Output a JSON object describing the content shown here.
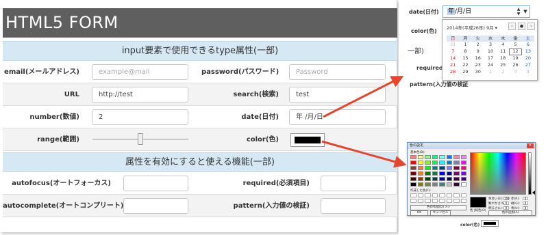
{
  "form": {
    "title": "HTML5 FORM",
    "section1_title": "input要素で使用できるtype属性(一部)",
    "section2_title": "属性を有効にすると使える機能(一部)",
    "rows": [
      {
        "left_label": "email(メールアドレス)",
        "left_placeholder": "example@mail",
        "right_label": "password(パスワード)",
        "right_placeholder": "Password"
      },
      {
        "left_label": "URL",
        "left_value": "http://test",
        "right_label": "search(検索)",
        "right_value": "test"
      },
      {
        "left_label": "number(数値)",
        "left_value": "2",
        "right_label": "date(日付)",
        "right_value": "年 /月/日"
      },
      {
        "left_label": "range(範囲)",
        "right_label": "color(色)"
      }
    ],
    "rows2": [
      {
        "left_label": "autofocus(オートフォーカス)",
        "right_label": "required(必須項目)"
      },
      {
        "left_label": "autocomplete(オートコンプリート)",
        "right_label": "pattern(入力値の検証)"
      }
    ],
    "range_value": 0.5,
    "color_value": "#000000"
  },
  "date_popup": {
    "field_label": "date(日付)",
    "input_year": "年",
    "input_rest": "/月/日",
    "spin_up": "▲",
    "spin_down": "▼",
    "dropdown": "▼",
    "month_label": "2014年(平成26年) 9月 ▾",
    "nav_prev": "‹",
    "nav_today": "●",
    "nav_next": "›",
    "weekdays": [
      "日",
      "月",
      "火",
      "水",
      "木",
      "金",
      "土"
    ],
    "weeks": [
      [
        "31",
        "1",
        "2",
        "3",
        "4",
        "5",
        "6"
      ],
      [
        "7",
        "8",
        "9",
        "10",
        "11",
        "12",
        "13"
      ],
      [
        "14",
        "15",
        "16",
        "17",
        "18",
        "19",
        "20"
      ],
      [
        "21",
        "22",
        "23",
        "24",
        "25",
        "26",
        "27"
      ],
      [
        "28",
        "29",
        "30",
        "1",
        "2",
        "3",
        "4"
      ]
    ],
    "today": "12",
    "side_color_label": "color(色)",
    "side_section_fragment": "一部)",
    "side_required": "required(必",
    "side_pattern": "pattern(入力値の検証"
  },
  "color_dialog": {
    "title": "色の設定",
    "close": "✕",
    "basic_label": "基本色(B):",
    "custom_label": "作成した色(C):",
    "define_button": "色の作成(D) >>",
    "ok_button": "OK",
    "cancel_button": "キャンセル",
    "add_button": "色の追加(A)",
    "color_label": "色 |純色(O)",
    "hue_label": "色合い(E):",
    "hue_value": "160",
    "sat_label": "鮮やかさ(S):",
    "sat_value": "0",
    "lum_label": "明るさ(L):",
    "lum_value": "0",
    "red_label": "赤(R):",
    "red_value": "0",
    "green_label": "緑(G):",
    "green_value": "0",
    "blue_label": "青(U):",
    "blue_value": "0",
    "basic_colors": [
      "#ff8080",
      "#ffff80",
      "#80ff80",
      "#00ff80",
      "#80ffff",
      "#0080ff",
      "#ff80c0",
      "#ff80ff",
      "#ff0000",
      "#ffff00",
      "#80ff00",
      "#00ff40",
      "#00ffff",
      "#0080c0",
      "#8080c0",
      "#ff00ff",
      "#804040",
      "#ff8040",
      "#00ff00",
      "#008080",
      "#004080",
      "#8080ff",
      "#800040",
      "#ff0080",
      "#800000",
      "#ff8000",
      "#008000",
      "#008040",
      "#0000ff",
      "#0000a0",
      "#800080",
      "#8000ff",
      "#400000",
      "#804000",
      "#004000",
      "#004040",
      "#000080",
      "#000040",
      "#400040",
      "#400080",
      "#000000",
      "#808000",
      "#808040",
      "#808080",
      "#408080",
      "#c0c0c0",
      "#400040",
      "#ffffff"
    ],
    "bottom_color_label": "color(色)"
  }
}
